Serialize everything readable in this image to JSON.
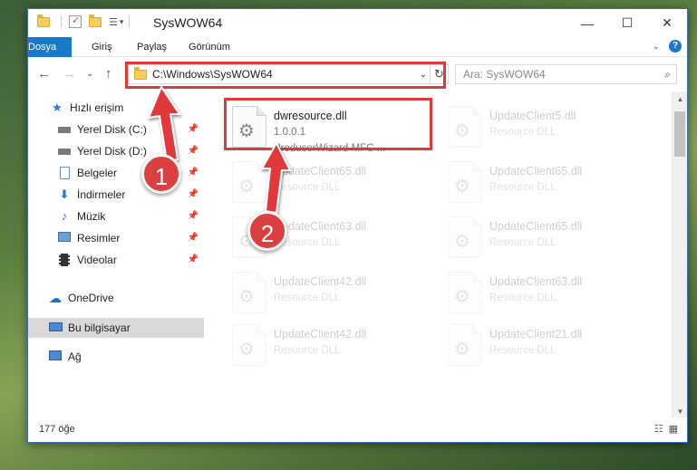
{
  "window": {
    "title": "SysWOW64",
    "controls": {
      "minimize": "—",
      "maximize": "☐",
      "close": "✕"
    }
  },
  "ribbon": {
    "tabs": [
      "Dosya",
      "Giriş",
      "Paylaş",
      "Görünüm"
    ]
  },
  "navigation": {
    "back": "←",
    "forward": "→",
    "recent": "⌄",
    "up": "↑",
    "address": "C:\\Windows\\SysWOW64",
    "search_placeholder": "Ara: SysWOW64"
  },
  "sidebar": {
    "items": [
      {
        "label": "Hızlı erişim",
        "icon": "star-icon"
      },
      {
        "label": "Yerel Disk (C:)",
        "icon": "drive-icon",
        "pinned": true
      },
      {
        "label": "Yerel Disk (D:)",
        "icon": "drive-icon",
        "pinned": true
      },
      {
        "label": "Belgeler",
        "icon": "documents-icon",
        "pinned": true
      },
      {
        "label": "İndirmeler",
        "icon": "download-icon",
        "pinned": true
      },
      {
        "label": "Müzik",
        "icon": "music-icon",
        "pinned": true
      },
      {
        "label": "Resimler",
        "icon": "pictures-icon",
        "pinned": true
      },
      {
        "label": "Videolar",
        "icon": "video-icon",
        "pinned": true
      },
      {
        "label": "OneDrive",
        "icon": "cloud-icon"
      },
      {
        "label": "Bu bilgisayar",
        "icon": "computer-icon",
        "selected": true
      },
      {
        "label": "Ağ",
        "icon": "network-icon"
      }
    ]
  },
  "files": [
    {
      "name": "dwresource.dll",
      "line2": "1.0.0.1",
      "line3": "ProducerWizard MFC ...",
      "highlight": true
    },
    {
      "name": "UpdateClient5.dll",
      "line2": "Resource DLL"
    },
    {
      "name": "UpdateClient65.dll",
      "line2": "Resource DLL"
    },
    {
      "name": "UpdateClient65.dll",
      "line2": "Resource DLL"
    },
    {
      "name": "UpdateClient63.dll",
      "line2": "Resource DLL"
    },
    {
      "name": "UpdateClient65.dll",
      "line2": "Resource DLL"
    },
    {
      "name": "UpdateClient42.dll",
      "line2": "Resource DLL"
    },
    {
      "name": "UpdateClient63.dll",
      "line2": "Resource DLL"
    },
    {
      "name": "UpdateClient42.dll",
      "line2": "Resource DLL"
    },
    {
      "name": "UpdateClient21.dll",
      "line2": "Resource DLL"
    }
  ],
  "status": {
    "item_count": "177 öğe"
  },
  "annotations": {
    "badge1": "1",
    "badge2": "2"
  },
  "colors": {
    "accent": "#1979ca",
    "annotation_red": "#e0393b",
    "selected_bg": "#d9d9d9"
  }
}
